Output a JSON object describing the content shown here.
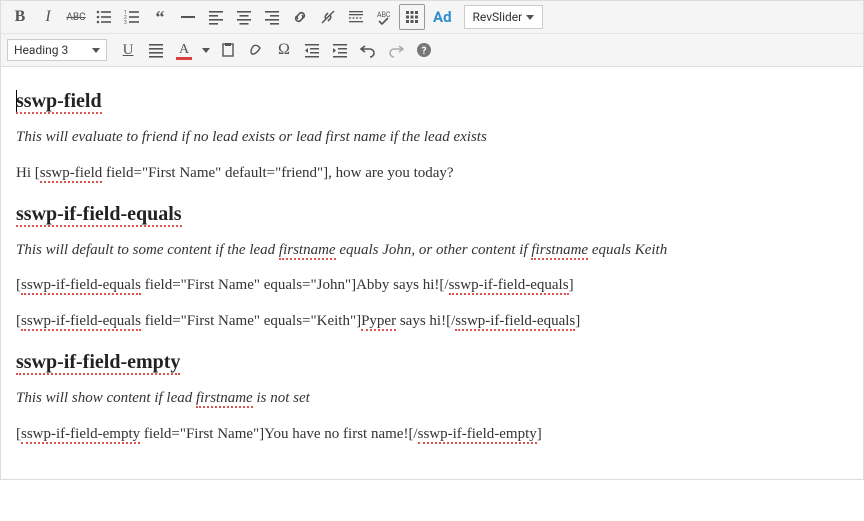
{
  "toolbar": {
    "row1": {
      "bold": "B",
      "italic": "I",
      "ad": "Ad",
      "revslider": "RevSlider"
    },
    "row2": {
      "format_select": "Heading 3",
      "underline": "U",
      "text_color": "A"
    }
  },
  "content": {
    "h1": "sswp-field",
    "p1": "This will evaluate to friend if no lead exists or lead first name if the lead exists",
    "p2_a": "Hi [",
    "p2_b": "sswp-field",
    "p2_c": " field=\"First Name\" default=\"friend\"], how are you today?",
    "h2": "sswp-if-field-equals",
    "p3_a": "This will default to some content if the lead ",
    "p3_b": "firstname",
    "p3_c": " equals John, or other content if ",
    "p3_d": "firstname",
    "p3_e": " equals Keith",
    "p4_a": "[",
    "p4_b": "sswp-if-field-equals",
    "p4_c": " field=\"First Name\" equals=\"John\"]Abby says hi![/",
    "p4_d": "sswp-if-field-equals",
    "p4_e": "]",
    "p5_a": "[",
    "p5_b": "sswp-if-field-equals",
    "p5_c": " field=\"First Name\" equals=\"Keith\"]",
    "p5_d": "Pyper",
    "p5_e": " says hi![/",
    "p5_f": "sswp-if-field-equals",
    "p5_g": "]",
    "h3": "sswp-if-field-empty",
    "p6_a": "This will show content if lead ",
    "p6_b": "firstname",
    "p6_c": " is not set",
    "p7_a": "[",
    "p7_b": "sswp-if-field-empty",
    "p7_c": " field=\"First Name\"]You have no first name![/",
    "p7_d": "sswp-if-field-empty",
    "p7_e": "]"
  }
}
